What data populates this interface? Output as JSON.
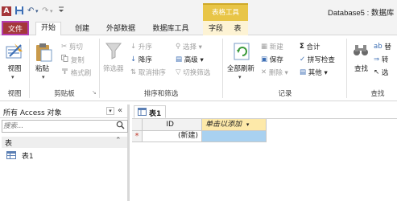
{
  "titlebar": {
    "app_icon": "A",
    "qat_undo": "↶",
    "qat_redo": "↷",
    "qat_menu": "▾",
    "context_tab": "表格工具",
    "database_title": "Database5 : 数据库"
  },
  "tabs": {
    "file": "文件",
    "home": "开始",
    "create": "创建",
    "external": "外部数据",
    "dbtools": "数据库工具",
    "fields": "字段",
    "table": "表"
  },
  "ribbon": {
    "view": {
      "label": "视图",
      "group": "视图"
    },
    "clipboard": {
      "paste": "粘贴",
      "cut": "剪切",
      "copy": "复制",
      "format_painter": "格式刷",
      "group": "剪贴板"
    },
    "sortfilter": {
      "filter": "筛选器",
      "asc": "升序",
      "desc": "降序",
      "remove_sort": "取消排序",
      "selection": "选择",
      "advanced": "高级",
      "toggle_filter": "切换筛选",
      "group": "排序和筛选"
    },
    "records": {
      "refresh_all": "全部刷新",
      "new": "新建",
      "save": "保存",
      "delete": "删除",
      "totals": "合计",
      "spelling": "拼写检查",
      "more": "其他",
      "group": "记录"
    },
    "find": {
      "find": "查找",
      "replace": "替",
      "goto": "转",
      "select": "选",
      "group": "查找"
    }
  },
  "navpane": {
    "title": "所有 Access 对象",
    "search_placeholder": "搜索...",
    "category": "表",
    "items": [
      "表1"
    ]
  },
  "document": {
    "tab_label": "表1",
    "columns": [
      "ID",
      "单击以添加"
    ],
    "new_row_marker": "*",
    "new_row_value": "(新建)"
  },
  "colors": {
    "file_tab": "#a4373a",
    "context_tab": "#e8c547",
    "add_column_highlight": "#fde9a9",
    "selected_cell": "#a9d1f0"
  }
}
